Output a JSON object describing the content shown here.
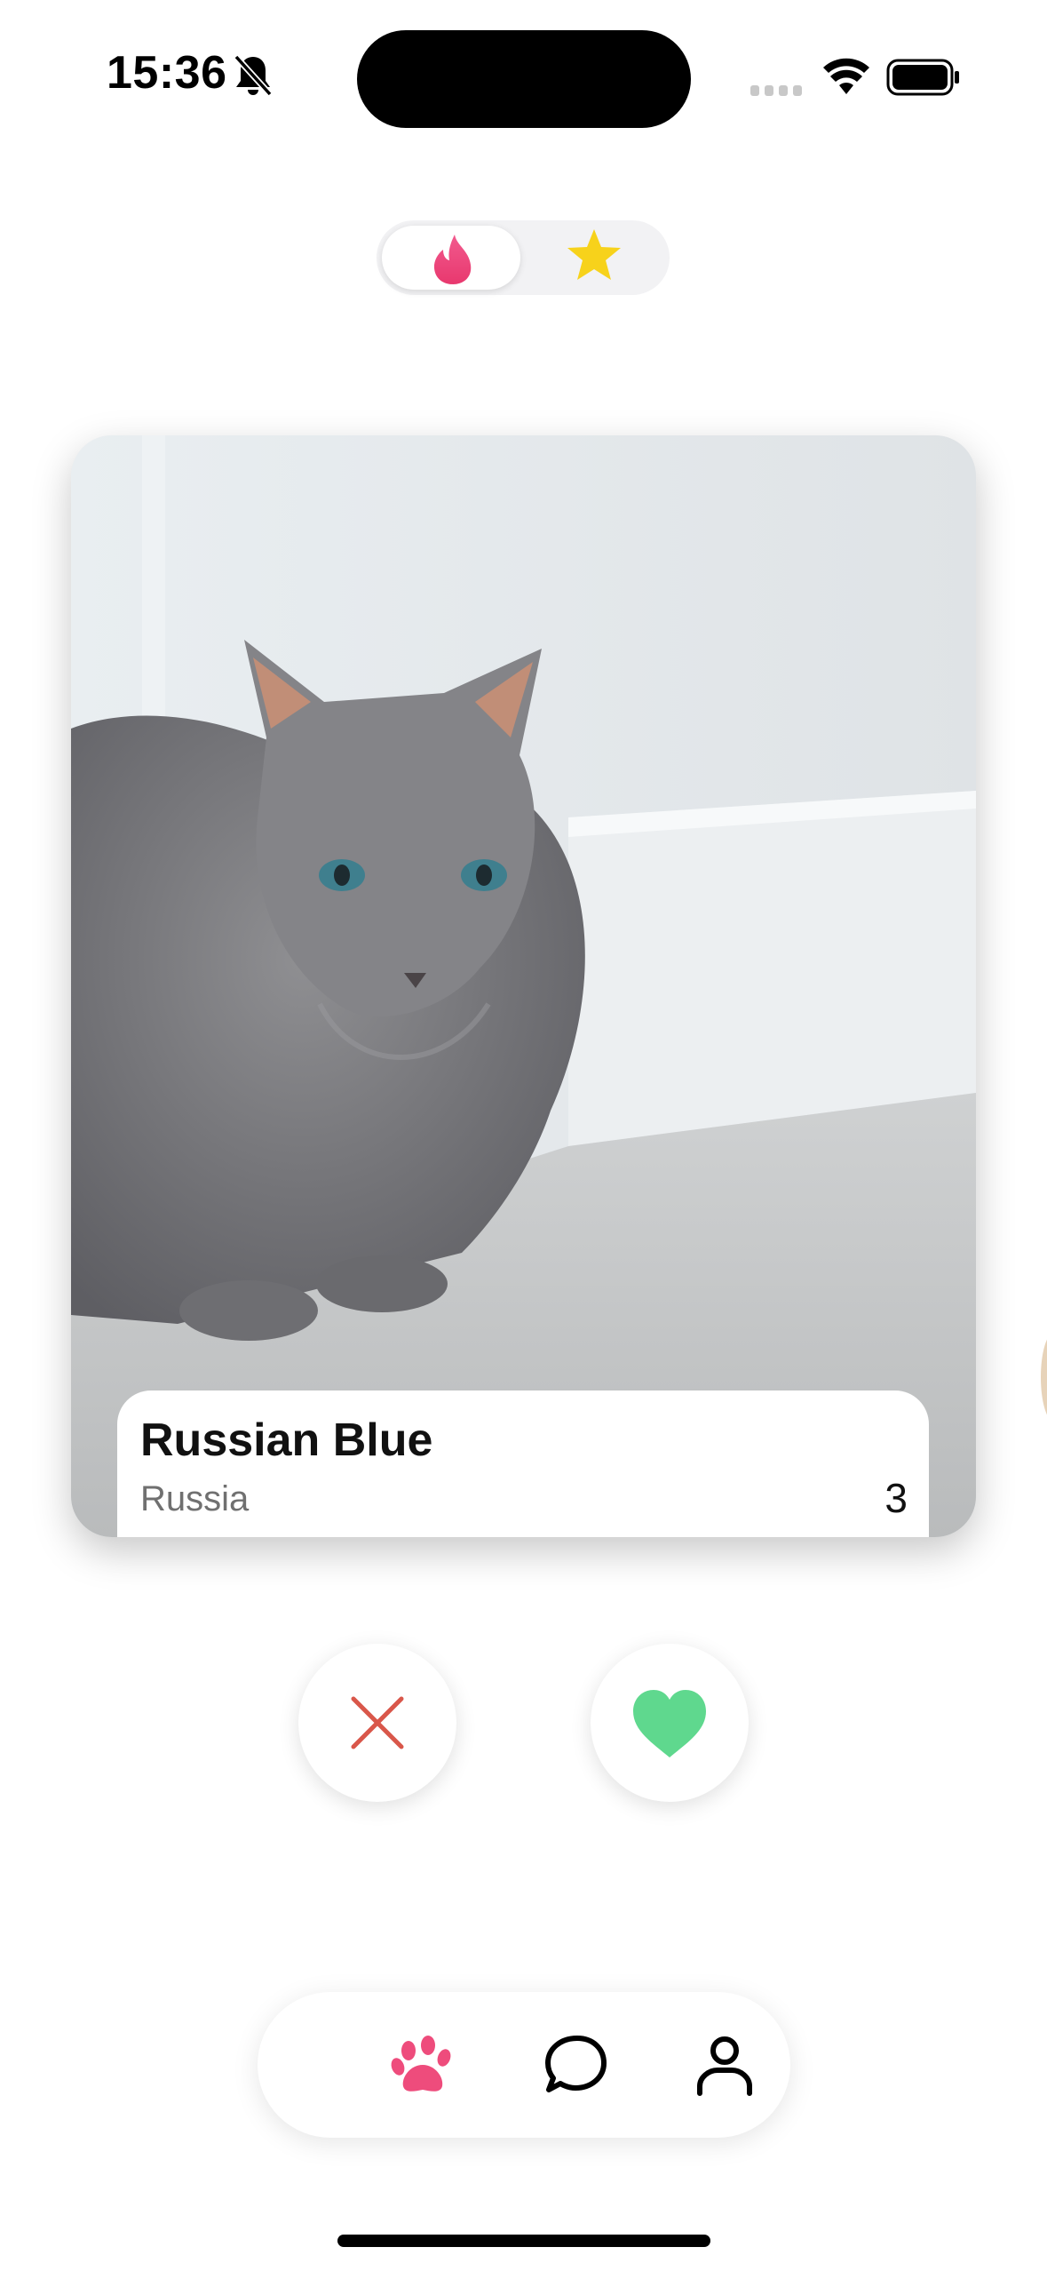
{
  "status_bar": {
    "time": "15:36",
    "icons": [
      "bell-slash-icon",
      "cellular-signal-icon",
      "wifi-icon",
      "battery-icon"
    ]
  },
  "mode_toggle": {
    "options": [
      {
        "icon": "flame-icon",
        "selected": true
      },
      {
        "icon": "star-icon",
        "selected": false
      }
    ]
  },
  "card": {
    "name": "Russian Blue",
    "origin": "Russia",
    "count": "3",
    "photo_icon": "cat-photo"
  },
  "actions": {
    "nope_icon": "close-icon",
    "like_icon": "heart-icon"
  },
  "tabbar": {
    "items": [
      {
        "icon": "paw-icon",
        "selected": true
      },
      {
        "icon": "chat-bubble-icon",
        "selected": false
      },
      {
        "icon": "person-icon",
        "selected": false
      }
    ]
  },
  "colors": {
    "accent_pink": "#ee4c7c",
    "star_yellow": "#f7d21b",
    "nope_red": "#d9574a",
    "like_green": "#5fd88e"
  }
}
